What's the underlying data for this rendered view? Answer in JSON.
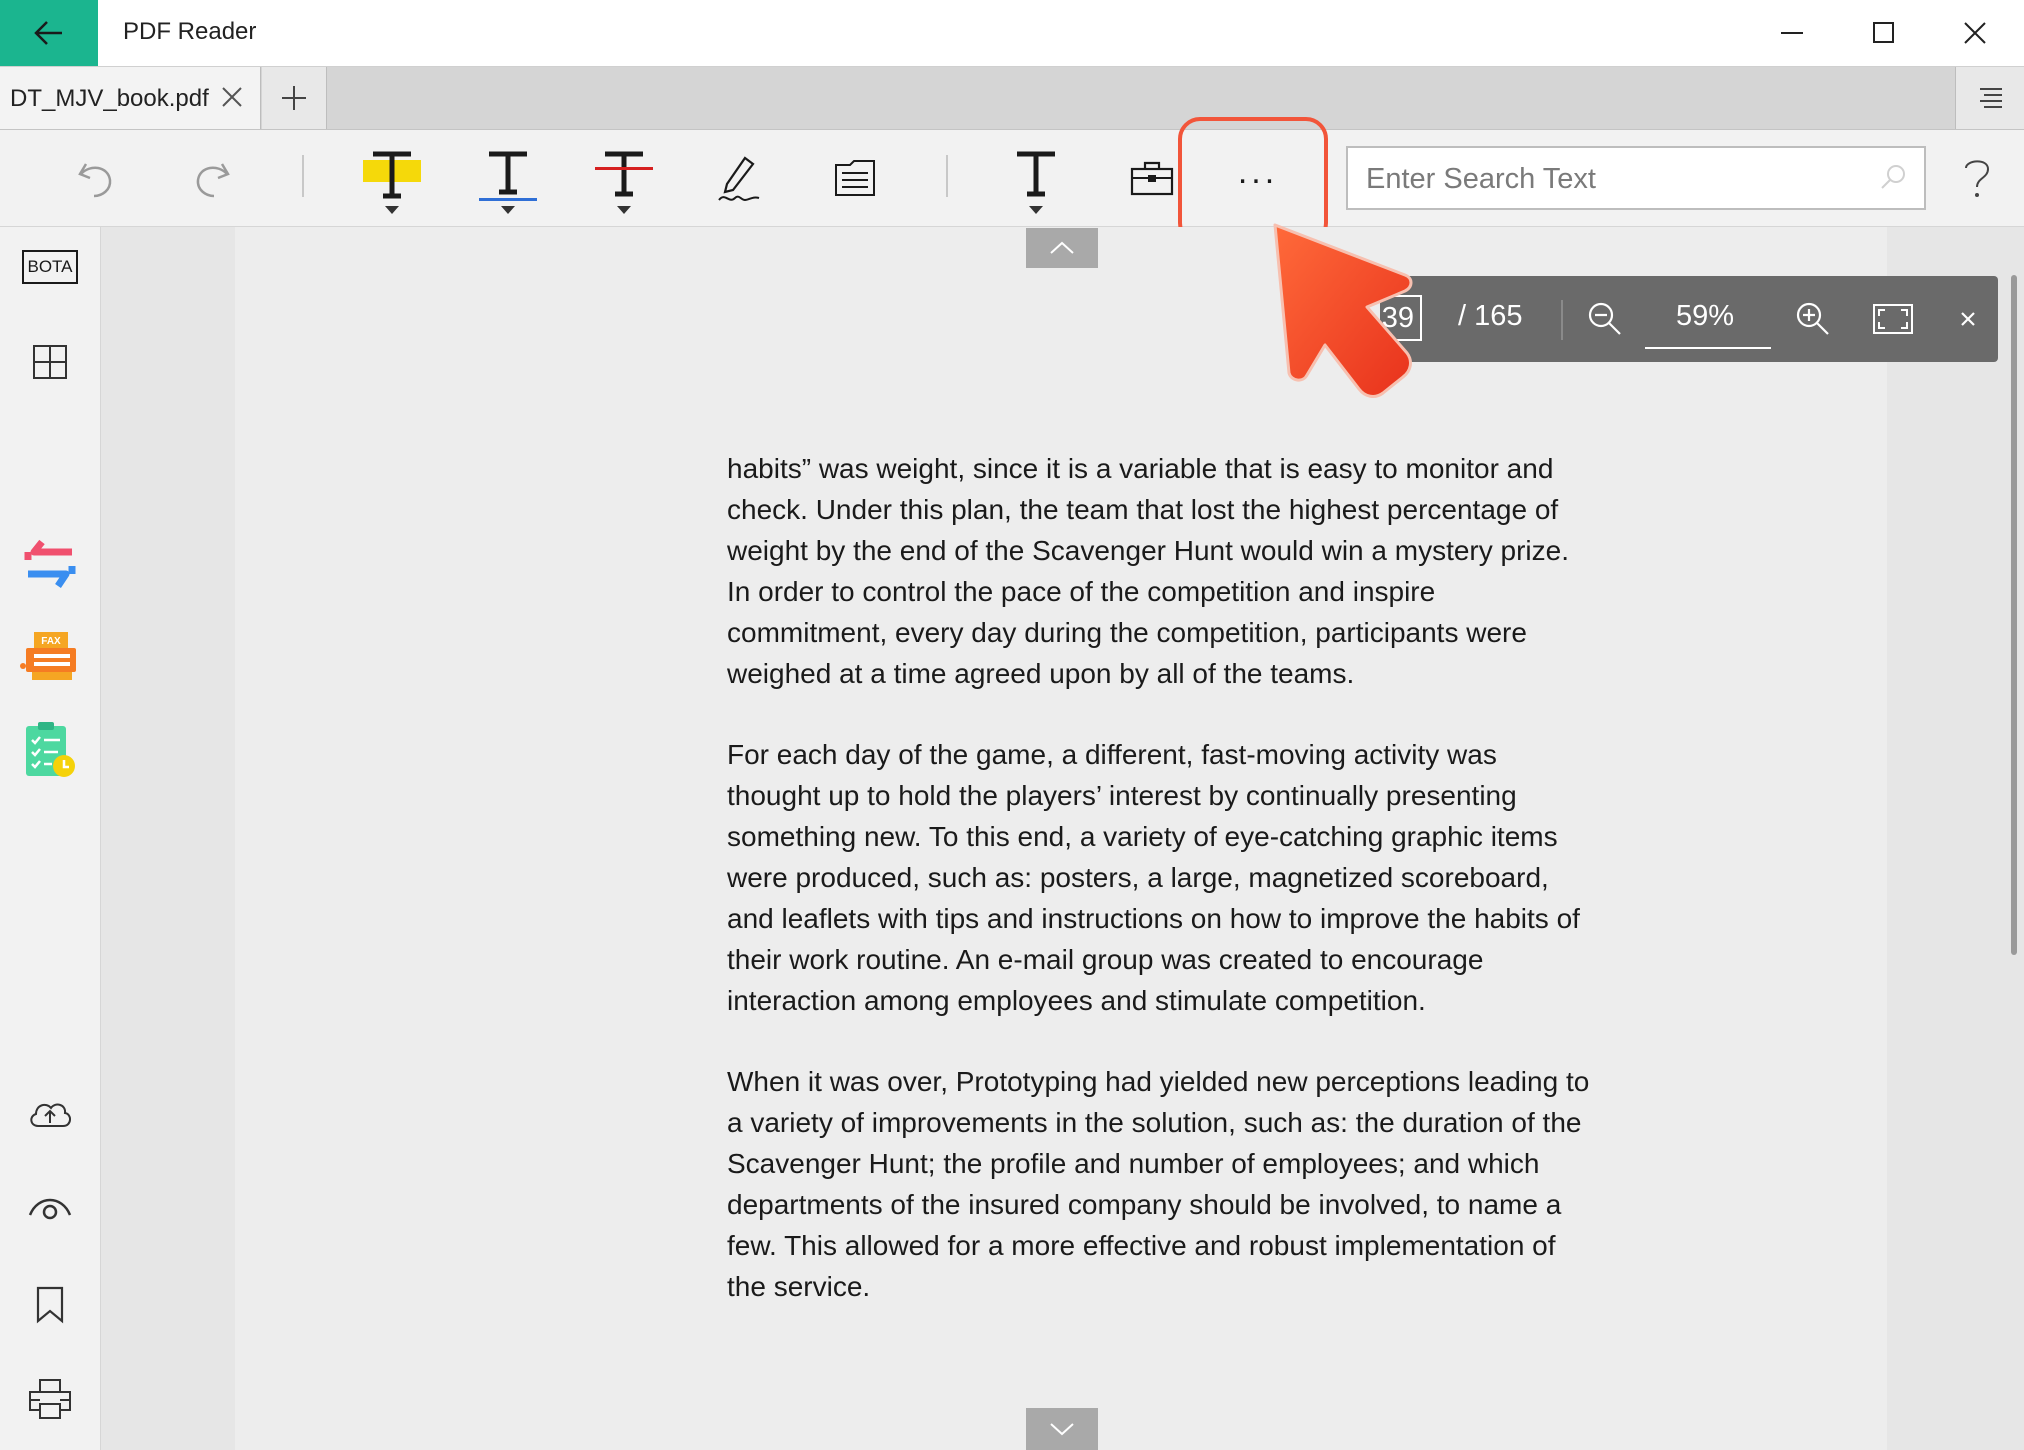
{
  "app": {
    "title": "PDF Reader"
  },
  "tab": {
    "filename": "DT_MJV_book.pdf"
  },
  "search": {
    "placeholder": "Enter Search Text"
  },
  "toolbar": {
    "more_label": "..."
  },
  "sidebar": {
    "bota_label": "BOTA",
    "fax_label": "FAX"
  },
  "page_nav": {
    "current_page": "39",
    "total_label": "/ 165",
    "zoom": "59%"
  },
  "document": {
    "paragraphs": [
      "habits” was weight, since it is a variable that is easy to monitor and check. Under this plan, the team that lost the highest percentage of weight by the end of the Scavenger Hunt would win a mystery prize. In order to control the pace of the competition and inspire commitment, every day during the competition, participants were weighed at a time agreed upon by all of the teams.",
      "For each day of the game, a different, fast-moving activity was thought up to hold the players’ interest by continually presenting something new.  To this end, a variety of eye-catching graphic items were produced, such as: posters, a large, magnetized scoreboard, and leaflets with tips and instructions on how to improve the habits of their work routine. An e-mail group was created to encourage interaction among employees and stimulate competition.",
      "When it was over, Prototyping had yielded new perceptions leading to a variety of improvements in the solution, such as: the duration of the Scavenger Hunt; the profile and number of employees; and which departments of the insured company should be involved, to name a few. This allowed for a more effective and robust implementation of the service."
    ]
  },
  "colors": {
    "accent": "#1bb58f",
    "highlight_yellow": "#f5d90a",
    "underline_blue": "#2f6fd6",
    "strike_red": "#d62020",
    "callout": "#f2553a"
  },
  "icons": [
    "back-arrow-icon",
    "minimize-icon",
    "maximize-icon",
    "close-icon",
    "tab-close-icon",
    "plus-icon",
    "tab-list-icon",
    "undo-icon",
    "redo-icon",
    "highlight-text-icon",
    "underline-text-icon",
    "strikethrough-text-icon",
    "signature-pen-icon",
    "note-icon",
    "text-box-icon",
    "toolbox-icon",
    "more-icon",
    "search-icon",
    "help-icon",
    "bota-icon",
    "thumbnails-grid-icon",
    "convert-icon",
    "fax-icon",
    "task-checklist-icon",
    "cloud-upload-icon",
    "eye-icon",
    "bookmark-icon",
    "print-icon",
    "zoom-out-icon",
    "zoom-in-icon",
    "fullscreen-icon",
    "chevron-up-icon",
    "chevron-down-icon",
    "cursor-arrow-icon"
  ]
}
